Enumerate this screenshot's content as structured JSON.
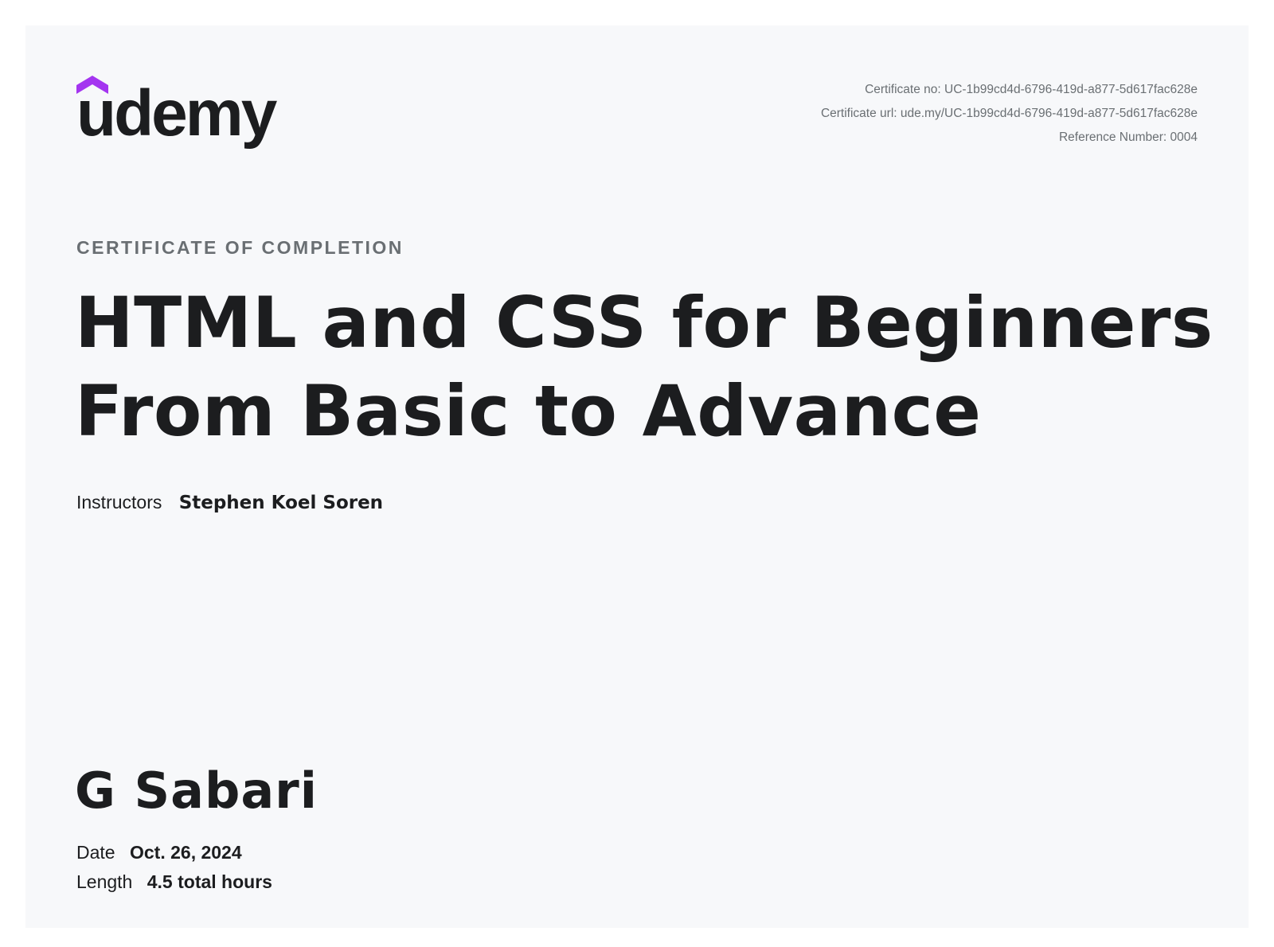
{
  "brand": {
    "name": "udemy",
    "accent_color": "#a435f0",
    "text_color": "#1c1d1f"
  },
  "meta": {
    "certificate_no": "Certificate no: UC-1b99cd4d-6796-419d-a877-5d617fac628e",
    "certificate_url": "Certificate url: ude.my/UC-1b99cd4d-6796-419d-a877-5d617fac628e",
    "reference_number": "Reference Number: 0004"
  },
  "certificate": {
    "eyebrow": "CERTIFICATE OF COMPLETION",
    "course_title_line1": "HTML and CSS for Beginners",
    "course_title_line2": "From Basic to Advance",
    "instructors_label": "Instructors",
    "instructors": "Stephen Koel Soren",
    "recipient": "G Sabari",
    "date_label": "Date",
    "date": "Oct. 26, 2024",
    "length_label": "Length",
    "length": "4.5 total hours"
  }
}
